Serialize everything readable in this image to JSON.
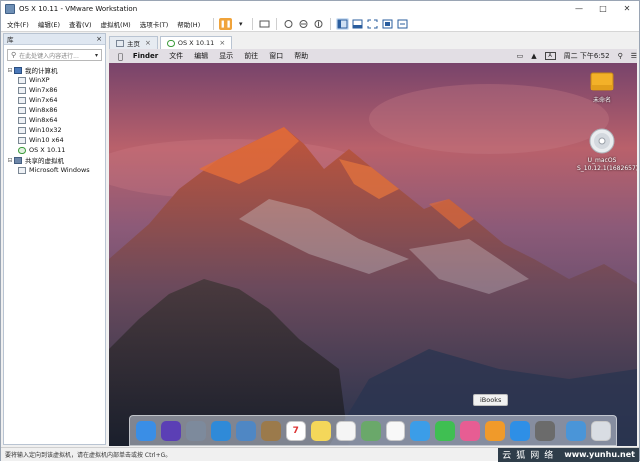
{
  "window": {
    "title": "OS X 10.11 - VMware Workstation"
  },
  "menu": {
    "items": [
      "文件(F)",
      "编辑(E)",
      "查看(V)",
      "虚拟机(M)",
      "选项卡(T)",
      "帮助(H)"
    ]
  },
  "library": {
    "title": "库",
    "close_glyph": "×",
    "search_placeholder": "在此处键入内容进行...",
    "tree": [
      {
        "label": "我的计算机",
        "level": 0,
        "icon": "pc"
      },
      {
        "label": "WinXP",
        "level": 1,
        "icon": "vm"
      },
      {
        "label": "Win7x86",
        "level": 1,
        "icon": "vm"
      },
      {
        "label": "Win7x64",
        "level": 1,
        "icon": "vm"
      },
      {
        "label": "Win8x86",
        "level": 1,
        "icon": "vm"
      },
      {
        "label": "Win8x64",
        "level": 1,
        "icon": "vm"
      },
      {
        "label": "Win10x32",
        "level": 1,
        "icon": "vm"
      },
      {
        "label": "Win10 x64",
        "level": 1,
        "icon": "vm"
      },
      {
        "label": "OS X 10.11",
        "level": 1,
        "icon": "mac"
      },
      {
        "label": "共享的虚拟机",
        "level": 0,
        "icon": "folder"
      },
      {
        "label": "Microsoft Windows",
        "level": 1,
        "icon": "vm"
      }
    ]
  },
  "tabs": [
    {
      "label": "主页",
      "active": false
    },
    {
      "label": "OS X 10.11",
      "active": true
    }
  ],
  "mac": {
    "menus": [
      "Finder",
      "文件",
      "编辑",
      "显示",
      "前往",
      "窗口",
      "帮助"
    ],
    "status": {
      "input": "A",
      "clock": "周二 下午6:52"
    }
  },
  "desktop": {
    "icons": [
      {
        "label": "未命名",
        "kind": "drive"
      },
      {
        "label": "U_macOS S_10.12.1(1682657)",
        "kind": "disc"
      }
    ]
  },
  "dock": {
    "tooltip": "iBooks",
    "apps": [
      {
        "name": "finder",
        "color": "#3a8ee6"
      },
      {
        "name": "siri",
        "color": "#5b3fb5"
      },
      {
        "name": "launchpad",
        "color": "#7d8a9c"
      },
      {
        "name": "safari",
        "color": "#2f8ad8"
      },
      {
        "name": "preview",
        "color": "#4f87c4"
      },
      {
        "name": "contacts",
        "color": "#9b7a4b"
      },
      {
        "name": "calendar",
        "color": "#ffffff"
      },
      {
        "name": "notes",
        "color": "#f4d75a"
      },
      {
        "name": "reminders",
        "color": "#f5f5f5"
      },
      {
        "name": "maps",
        "color": "#6aa86a"
      },
      {
        "name": "photos",
        "color": "#f8f8f8"
      },
      {
        "name": "messages",
        "color": "#3b9de8"
      },
      {
        "name": "facetime",
        "color": "#3fbf52"
      },
      {
        "name": "itunes",
        "color": "#e75d93"
      },
      {
        "name": "ibooks",
        "color": "#f09a2a"
      },
      {
        "name": "app-store",
        "color": "#2e8fe6"
      },
      {
        "name": "system-preferences",
        "color": "#6b6b6b"
      },
      {
        "name": "downloads",
        "color": "#4a95d8"
      },
      {
        "name": "trash",
        "color": "#d9dde3"
      }
    ],
    "calendar_day": "7"
  },
  "statusbar": {
    "text": "要将输入定向到该虚拟机，请在虚拟机内部单击或按 Ctrl+G。",
    "watermark_cn": "云狐网络",
    "watermark_url": "www.yunhu.net"
  }
}
